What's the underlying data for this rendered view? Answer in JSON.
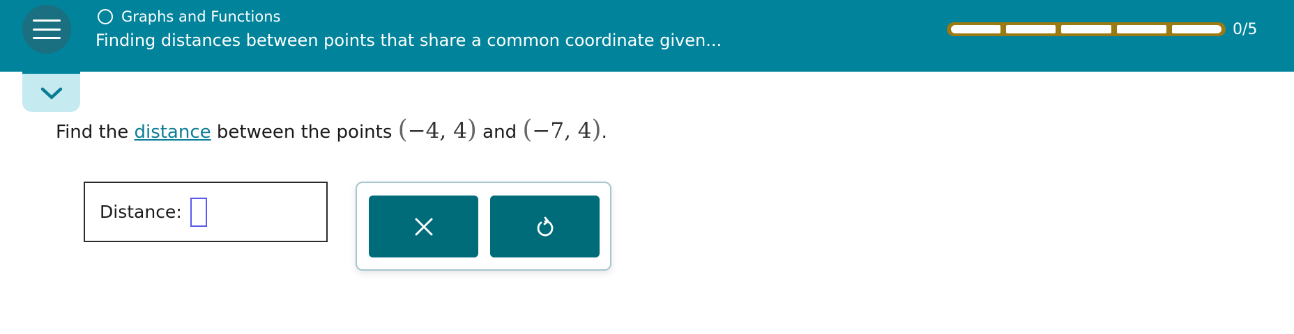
{
  "header": {
    "topic": "Graphs and Functions",
    "subtitle": "Finding distances between points that share a common coordinate given...",
    "progress": {
      "text": "0/5",
      "completed": 0,
      "total": 5
    }
  },
  "icons": {
    "menu": "hamburger-menu-icon",
    "topic": "circle-outline-icon",
    "collapse": "chevron-down-icon",
    "clear": "close-x-icon",
    "reset": "undo-arrow-icon"
  },
  "question": {
    "prefix": "Find the ",
    "link": "distance",
    "middle": " between the points ",
    "point1": "−4, 4",
    "connector": " and ",
    "point2": "−7, 4",
    "suffix": "."
  },
  "answer": {
    "label": "Distance:",
    "value": ""
  },
  "colors": {
    "header_bg": "#00839b",
    "progress_track": "#9b7a12",
    "tool_button": "#006b79",
    "link": "#0a7d96",
    "input_border": "#5b5bea"
  }
}
